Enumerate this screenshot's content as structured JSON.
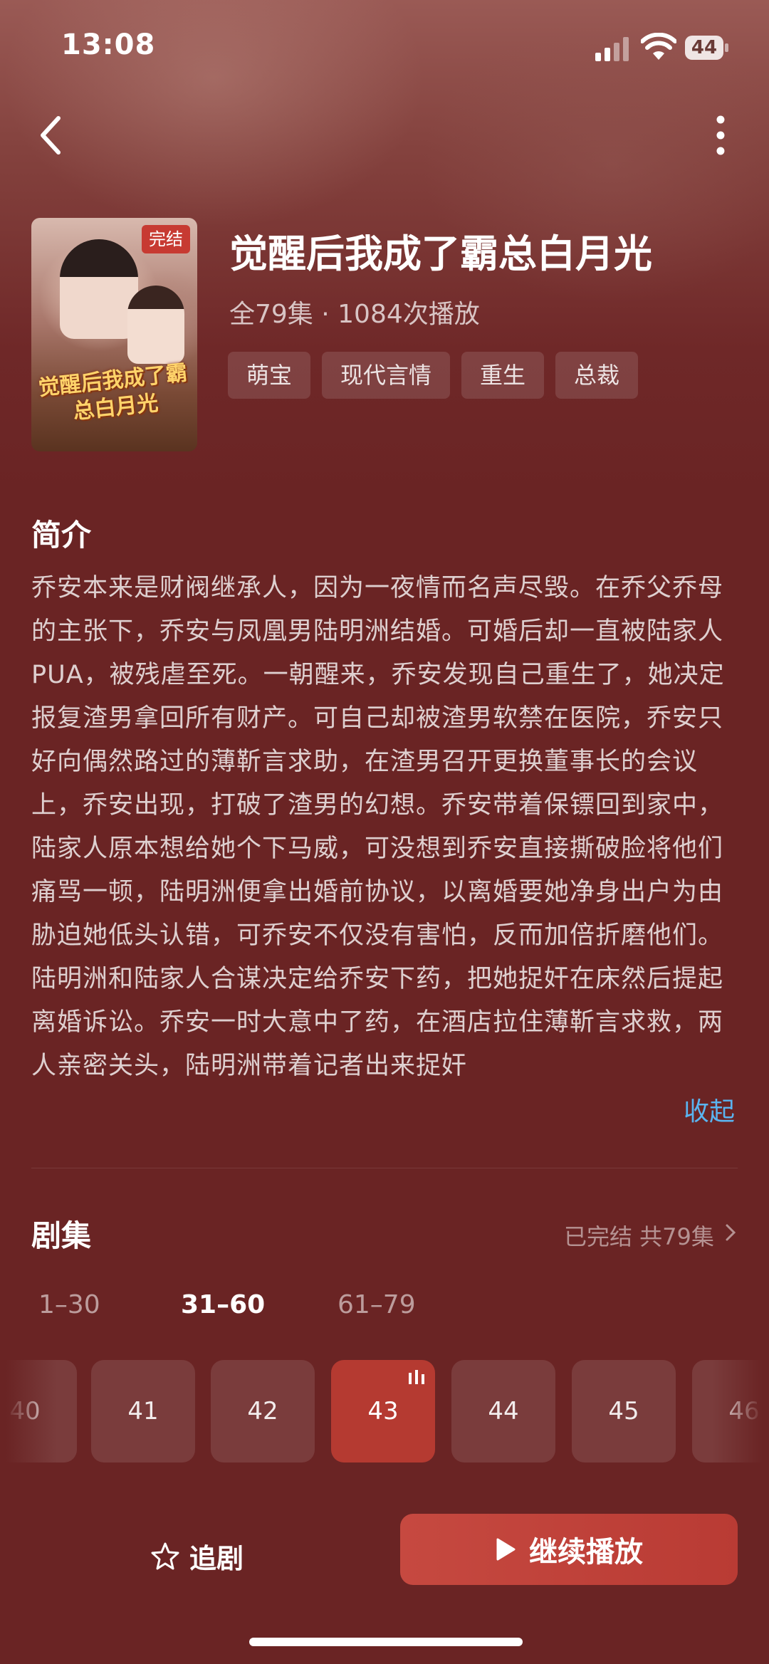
{
  "status_bar": {
    "time": "13:08",
    "battery": "44"
  },
  "drama": {
    "badge": "完结",
    "title": "觉醒后我成了霸总白月光",
    "meta": "全79集 · 1084次播放",
    "poster_text": "觉醒后我成了霸总白月光",
    "tags": [
      "萌宝",
      "现代言情",
      "重生",
      "总裁"
    ]
  },
  "intro": {
    "heading": "简介",
    "synopsis": "乔安本来是财阀继承人，因为一夜情而名声尽毁。在乔父乔母的主张下，乔安与凤凰男陆明洲结婚。可婚后却一直被陆家人PUA，被残虐至死。一朝醒来，乔安发现自己重生了，她决定报复渣男拿回所有财产。可自己却被渣男软禁在医院，乔安只好向偶然路过的薄靳言求助，在渣男召开更换董事长的会议上，乔安出现，打破了渣男的幻想。乔安带着保镖回到家中，陆家人原本想给她个下马威，可没想到乔安直接撕破脸将他们痛骂一顿，陆明洲便拿出婚前协议，以离婚要她净身出户为由胁迫她低头认错，可乔安不仅没有害怕，反而加倍折磨他们。陆明洲和陆家人合谋决定给乔安下药，把她捉奸在床然后提起离婚诉讼。乔安一时大意中了药，在酒店拉住薄靳言求救，两人亲密关头，陆明洲带着记者出来捉奸",
    "collapse_label": "收起"
  },
  "episodes": {
    "heading": "剧集",
    "status": "已完结 共79集",
    "ranges": [
      "1–30",
      "31–60",
      "61–79"
    ],
    "active_range": 1,
    "items": [
      "40",
      "41",
      "42",
      "43",
      "44",
      "45",
      "46"
    ],
    "current": "43"
  },
  "actions": {
    "follow_label": "追剧",
    "play_label": "继续播放"
  },
  "colors": {
    "background": "#6a2424",
    "accent": "#b53a31",
    "link": "#5ab4f0"
  },
  "icons": [
    "back-icon",
    "more-icon",
    "signal-icon",
    "wifi-icon",
    "battery-icon",
    "star-icon",
    "play-icon",
    "playing-icon",
    "chevron-right-icon"
  ]
}
